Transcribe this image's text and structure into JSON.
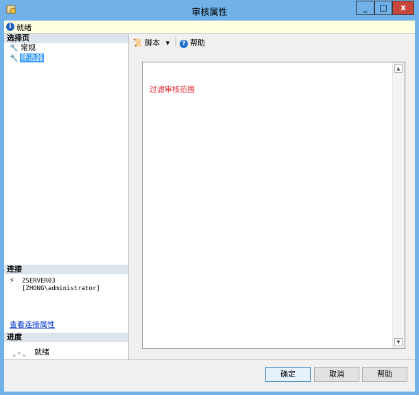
{
  "window": {
    "title": "审核属性",
    "minimize_glyph": "_",
    "maximize_glyph": "□",
    "close_glyph": "x"
  },
  "status": {
    "icon_glyph": "i",
    "text": "就绪"
  },
  "left": {
    "select_page_heading": "选择页",
    "pages": [
      {
        "label": "常规",
        "icon": "wrench-icon",
        "selected": false
      },
      {
        "label": "筛选器",
        "icon": "wrench-icon",
        "selected": true
      }
    ],
    "connection_heading": "连接",
    "connection_text": "ZSERVER03\n[ZHONG\\administrator]",
    "connection_link": "查看连接属性",
    "progress_heading": "进度",
    "progress_text": "就绪"
  },
  "toolbar": {
    "script_label": "脚本",
    "dropdown_glyph": "▾",
    "help_label": "帮助",
    "help_glyph": "?"
  },
  "editor": {
    "content": "过滤审核范围"
  },
  "buttons": {
    "ok": "确定",
    "cancel": "取消",
    "help": "帮助"
  },
  "colors": {
    "titlebar": "#6fb1e8",
    "close_button": "#c7463c",
    "selection": "#3399ff",
    "editor_text": "#e0212a"
  }
}
